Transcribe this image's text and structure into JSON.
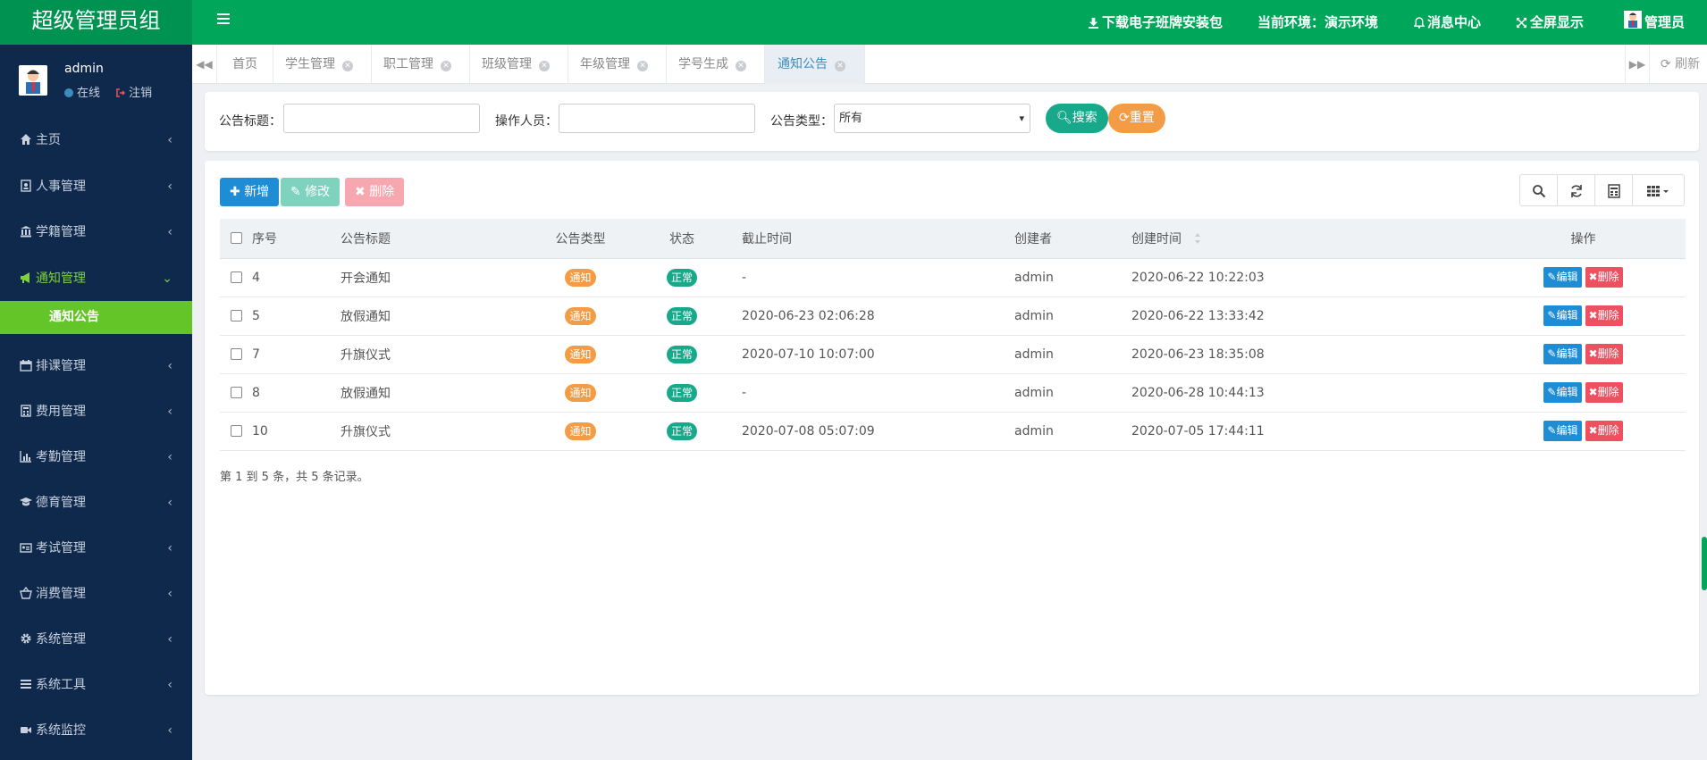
{
  "header": {
    "brand": "超级管理员组",
    "download": "下载电子班牌安装包",
    "env": "当前环境：演示环境",
    "messages": "消息中心",
    "fullscreen": "全屏显示",
    "user": "管理员"
  },
  "sidebar": {
    "username": "admin",
    "online": "在线",
    "logout": "注销",
    "items": [
      {
        "label": "主页",
        "icon": "home-icon"
      },
      {
        "label": "人事管理",
        "icon": "id-card-icon"
      },
      {
        "label": "学籍管理",
        "icon": "bank-icon"
      },
      {
        "label": "通知管理",
        "icon": "bullhorn-icon"
      },
      {
        "label": "排课管理",
        "icon": "calendar-icon"
      },
      {
        "label": "费用管理",
        "icon": "calculator-icon"
      },
      {
        "label": "考勤管理",
        "icon": "bar-chart-icon"
      },
      {
        "label": "德育管理",
        "icon": "graduation-cap-icon"
      },
      {
        "label": "考试管理",
        "icon": "id-badge-icon"
      },
      {
        "label": "消费管理",
        "icon": "basket-icon"
      },
      {
        "label": "系统管理",
        "icon": "gear-icon"
      },
      {
        "label": "系统工具",
        "icon": "list-icon"
      },
      {
        "label": "系统监控",
        "icon": "video-camera-icon"
      }
    ],
    "active_sub": "通知公告"
  },
  "tabs": [
    {
      "label": "首页"
    },
    {
      "label": "学生管理"
    },
    {
      "label": "职工管理"
    },
    {
      "label": "班级管理"
    },
    {
      "label": "年级管理"
    },
    {
      "label": "学号生成"
    },
    {
      "label": "通知公告"
    }
  ],
  "tab_refresh": "刷新",
  "search": {
    "title_label": "公告标题：",
    "operator_label": "操作人员：",
    "type_label": "公告类型：",
    "type_selected": "所有",
    "search_btn": "搜索",
    "reset_btn": "重置"
  },
  "toolbar": {
    "add": "新增",
    "edit": "修改",
    "delete": "删除"
  },
  "table": {
    "headers": [
      "序号",
      "公告标题",
      "公告类型",
      "状态",
      "截止时间",
      "创建者",
      "创建时间",
      "操作"
    ],
    "rows": [
      {
        "id": "4",
        "title": "开会通知",
        "type": "通知",
        "status": "正常",
        "deadline": "-",
        "creator": "admin",
        "created": "2020-06-22 10:22:03"
      },
      {
        "id": "5",
        "title": "放假通知",
        "type": "通知",
        "status": "正常",
        "deadline": "2020-06-23 02:06:28",
        "creator": "admin",
        "created": "2020-06-22 13:33:42"
      },
      {
        "id": "7",
        "title": "升旗仪式",
        "type": "通知",
        "status": "正常",
        "deadline": "2020-07-10 10:07:00",
        "creator": "admin",
        "created": "2020-06-23 18:35:08"
      },
      {
        "id": "8",
        "title": "放假通知",
        "type": "通知",
        "status": "正常",
        "deadline": "-",
        "creator": "admin",
        "created": "2020-06-28 10:44:13"
      },
      {
        "id": "10",
        "title": "升旗仪式",
        "type": "通知",
        "status": "正常",
        "deadline": "2020-07-08 05:07:09",
        "creator": "admin",
        "created": "2020-07-05 17:44:11"
      }
    ],
    "row_edit": "编辑",
    "row_delete": "删除",
    "summary": "第 1 到 5 条，共 5 条记录。"
  },
  "colors": {
    "header": "#00a65a",
    "sidebar": "#0f294d",
    "active_sub": "#64c528",
    "primary": "#1f8dd6",
    "danger": "#ef5060",
    "warning": "#f39c45",
    "success": "#17a98a"
  }
}
